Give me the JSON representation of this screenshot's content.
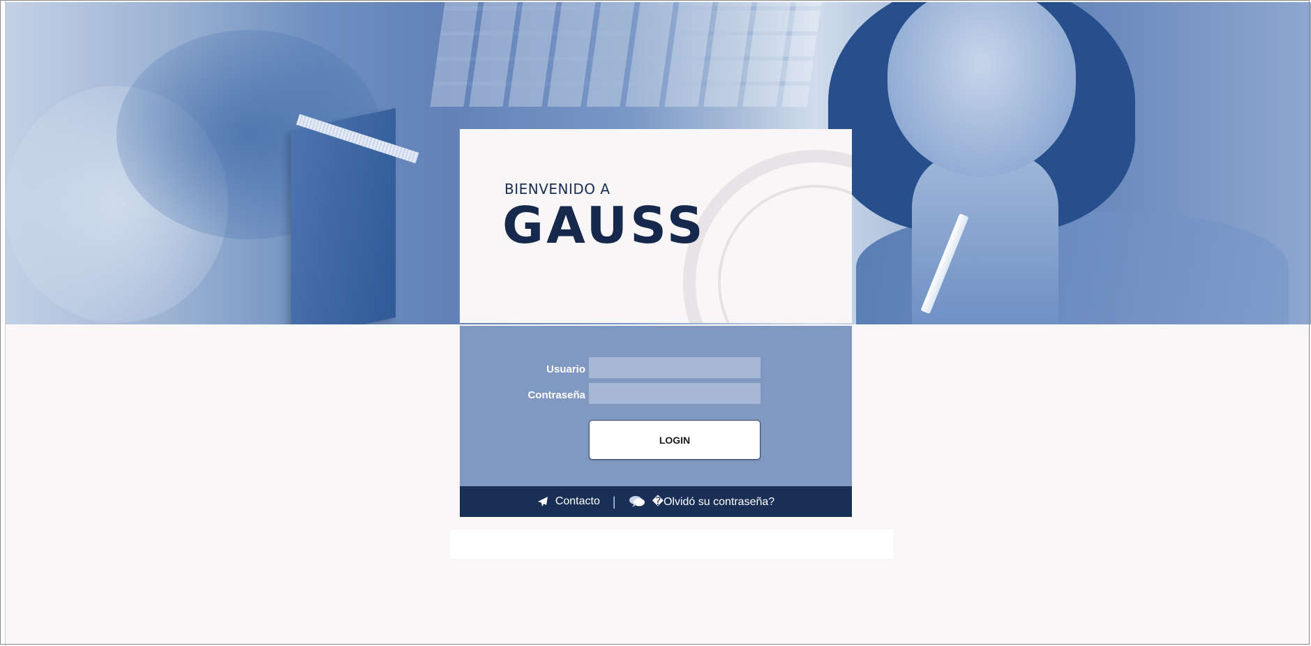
{
  "login": {
    "welcome": "BIENVENIDO A",
    "app_name": "GAUSS",
    "username_label": "Usuario",
    "username_value": "",
    "password_label": "Contraseña",
    "password_value": "",
    "login_button": "LOGIN"
  },
  "footer": {
    "contact": "Contacto",
    "separator": "|",
    "forgot_password": "�Olvidó su contraseña?"
  },
  "icons": {
    "contact": "paper-plane-icon",
    "forgot": "chat-bubble-icon"
  },
  "colors": {
    "form_bg": "#8199c1",
    "footer_bg": "#1a2f56",
    "title": "#16294d"
  }
}
